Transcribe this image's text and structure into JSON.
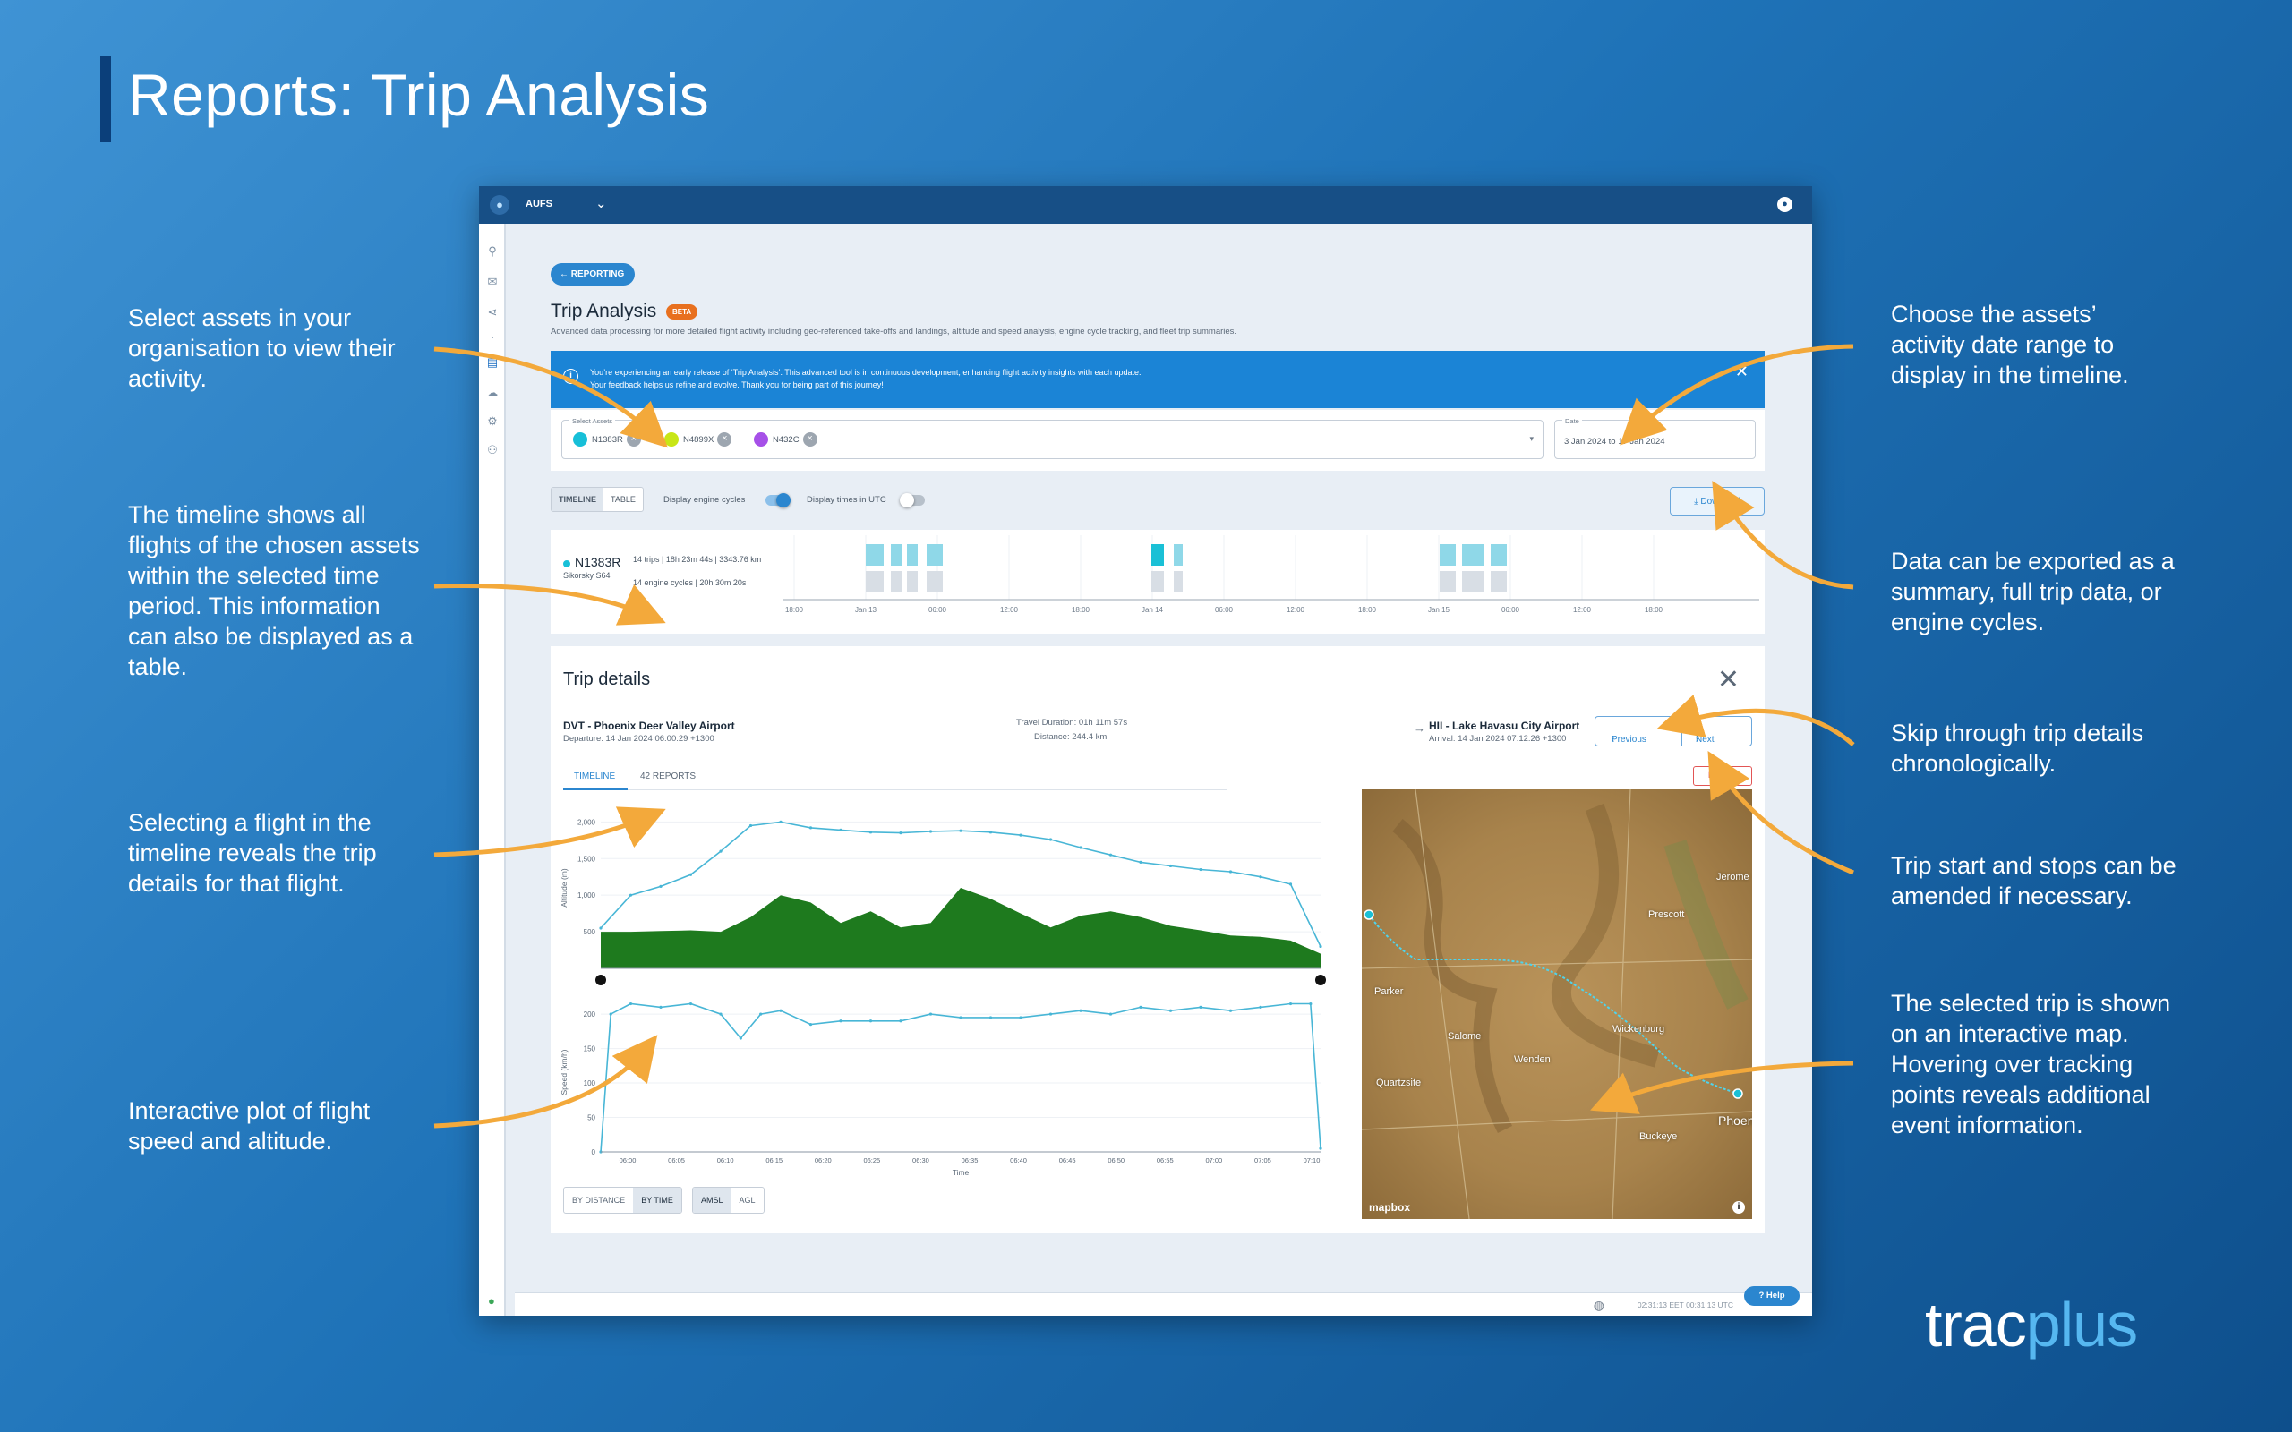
{
  "slide": {
    "title": "Reports: Trip Analysis",
    "logo_part1": "trac",
    "logo_part2": "plus"
  },
  "annotations": {
    "select_assets": "Select assets in your organisation to view their activity.",
    "timeline": "The timeline shows all flights of the chosen assets within the selected time period. This information can also be displayed as a table.",
    "select_flight": "Selecting a flight in the timeline reveals the trip details for that flight.",
    "plot": "Interactive plot of flight speed and altitude.",
    "date_range": "Choose the assets’ activity date range to display in the timeline.",
    "export": "Data can be exported as a summary, full trip data, or engine cycles.",
    "skip": "Skip through trip details chronologically.",
    "amend": "Trip start and stops can be amended if necessary.",
    "map": "The selected trip is shown on an interactive map. Hovering over tracking points reveals additional event information."
  },
  "app": {
    "org": "AUFS",
    "back_button": "REPORTING",
    "page_title": "Trip Analysis",
    "beta_badge": "BETA",
    "page_desc": "Advanced data processing for more detailed flight activity including geo-referenced take-offs and landings, altitude and speed analysis, engine cycle tracking, and fleet trip summaries.",
    "banner_line1": "You’re experiencing an early release of ‘Trip Analysis’. This advanced tool is in continuous development, enhancing flight activity insights with each update.",
    "banner_line2": "Your feedback helps us refine and evolve. Thank you for being part of this journey!",
    "select_assets_label": "Select Assets",
    "assets": [
      {
        "label": "N1383R",
        "color": "#17bfd8"
      },
      {
        "label": "N4899X",
        "color": "#c8e616"
      },
      {
        "label": "N432C",
        "color": "#a650e8"
      }
    ],
    "date_label": "Date",
    "date_value": "3 Jan 2024 to 17 Jan 2024",
    "view_tabs": [
      "TIMELINE",
      "TABLE"
    ],
    "toggle_engine": "Display engine cycles",
    "toggle_utc": "Display times in UTC",
    "download": "Download",
    "timeline": {
      "registration": "N1383R",
      "model": "Sikorsky S64",
      "stats1": "14 trips | 18h 23m 44s | 3343.76 km",
      "stats2": "14 engine cycles | 20h 30m 20s",
      "ticks": [
        "18:00",
        "Jan 13",
        "06:00",
        "12:00",
        "18:00",
        "Jan 14",
        "06:00",
        "12:00",
        "18:00",
        "Jan 15",
        "06:00",
        "12:00",
        "18:00"
      ]
    },
    "trip": {
      "title": "Trip details",
      "dep_name": "DVT - Phoenix Deer Valley Airport",
      "dep_time": "Departure: 14 Jan 2024 06:00:29 +1300",
      "duration": "Travel Duration: 01h 11m 57s",
      "distance": "Distance: 244.4 km",
      "arr_name": "HII - Lake Havasu City Airport",
      "arr_time": "Arrival: 14 Jan 2024 07:12:26 +1300",
      "prev": "Previous",
      "next": "Next",
      "tab_timeline": "TIMELINE",
      "tab_reports": "42 REPORTS",
      "edit": "Edit trip",
      "seg1": [
        "BY DISTANCE",
        "BY TIME"
      ],
      "seg2": [
        "AMSL",
        "AGL"
      ],
      "mapbox": "mapbox",
      "map_labels": [
        "Prescott",
        "Jerome",
        "Parker",
        "Wickenburg",
        "Quartzsite",
        "Buckeye",
        "Phoen",
        "Salome",
        "Wenden"
      ]
    },
    "status_time": "02:31:13 EET 00:31:13 UTC",
    "help": "Help"
  },
  "chart_data": [
    {
      "type": "area",
      "title": "",
      "xlabel": "",
      "ylabel": "Altitude (m)",
      "ylim": [
        0,
        2200
      ],
      "y_ticks": [
        "500",
        "1,000",
        "1,500",
        "2,000"
      ],
      "x": [
        0,
        3,
        6,
        9,
        12,
        15,
        18,
        21,
        24,
        27,
        30,
        33,
        36,
        39,
        42,
        45,
        48,
        51,
        54,
        57,
        60,
        63,
        66,
        69,
        72
      ],
      "series": [
        {
          "values": [
            550,
            1000,
            1120,
            1280,
            1600,
            1950,
            2000,
            1920,
            1890,
            1860,
            1850,
            1870,
            1880,
            1860,
            1820,
            1760,
            1650,
            1550,
            1450,
            1400,
            1350,
            1320,
            1250,
            1150,
            300
          ]
        },
        {
          "values": [
            500,
            500,
            510,
            520,
            500,
            700,
            1000,
            900,
            620,
            780,
            560,
            620,
            1100,
            950,
            750,
            560,
            720,
            780,
            700,
            580,
            520,
            450,
            430,
            380,
            200
          ]
        }
      ]
    },
    {
      "type": "line",
      "title": "",
      "xlabel": "Time",
      "ylabel": "Speed (km/h)",
      "ylim": [
        0,
        230
      ],
      "y_ticks": [
        "0",
        "50",
        "100",
        "150",
        "200"
      ],
      "x_ticks": [
        "06:00",
        "06:05",
        "06:10",
        "06:15",
        "06:20",
        "06:25",
        "06:30",
        "06:35",
        "06:40",
        "06:45",
        "06:50",
        "06:55",
        "07:00",
        "07:05",
        "07:10"
      ],
      "x": [
        0,
        1,
        3,
        6,
        9,
        12,
        14,
        16,
        18,
        21,
        24,
        27,
        30,
        33,
        36,
        39,
        42,
        45,
        48,
        51,
        54,
        57,
        60,
        63,
        66,
        69,
        71,
        72
      ],
      "series": [
        {
          "values": [
            0,
            200,
            215,
            210,
            215,
            200,
            165,
            200,
            205,
            185,
            190,
            190,
            190,
            200,
            195,
            195,
            195,
            200,
            205,
            200,
            210,
            205,
            210,
            205,
            210,
            215,
            215,
            5
          ]
        }
      ]
    }
  ]
}
